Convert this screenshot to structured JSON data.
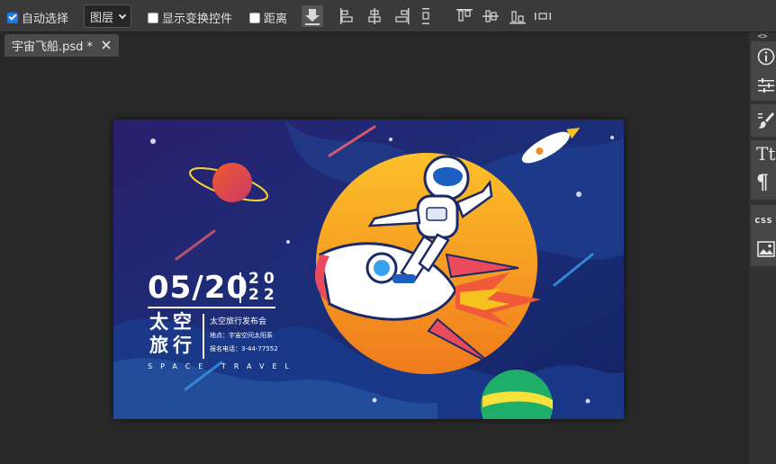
{
  "toolbar": {
    "auto_select_label": "自动选择",
    "auto_select_checked": true,
    "layer_select_value": "图层",
    "show_transform_label": "显示变换控件",
    "show_transform_checked": false,
    "distance_label": "距离",
    "distance_checked": false
  },
  "tab": {
    "title": "宇宙飞船.psd *"
  },
  "panel": {
    "collapse_glyph": "<>",
    "text_icon_glyph": "Tt",
    "paragraph_icon_glyph": "¶",
    "css_icon_label": "css"
  },
  "poster": {
    "date": "05/20",
    "year_top": "20",
    "year_bottom": "22",
    "title_line1": "太空",
    "title_line2": "旅行",
    "event_name": "太空旅行发布会",
    "location": "地点：宇宙空间太阳系",
    "phone": "报名电话：3-44-77552",
    "tagline": "SPACE TRAVEL"
  },
  "colors": {
    "accent_blue": "#1e7ae6",
    "bg_dark": "#282828",
    "toolbar": "#3a3a3a",
    "poster_bg": "#1d2a6a",
    "sun": "#f7a21e"
  }
}
